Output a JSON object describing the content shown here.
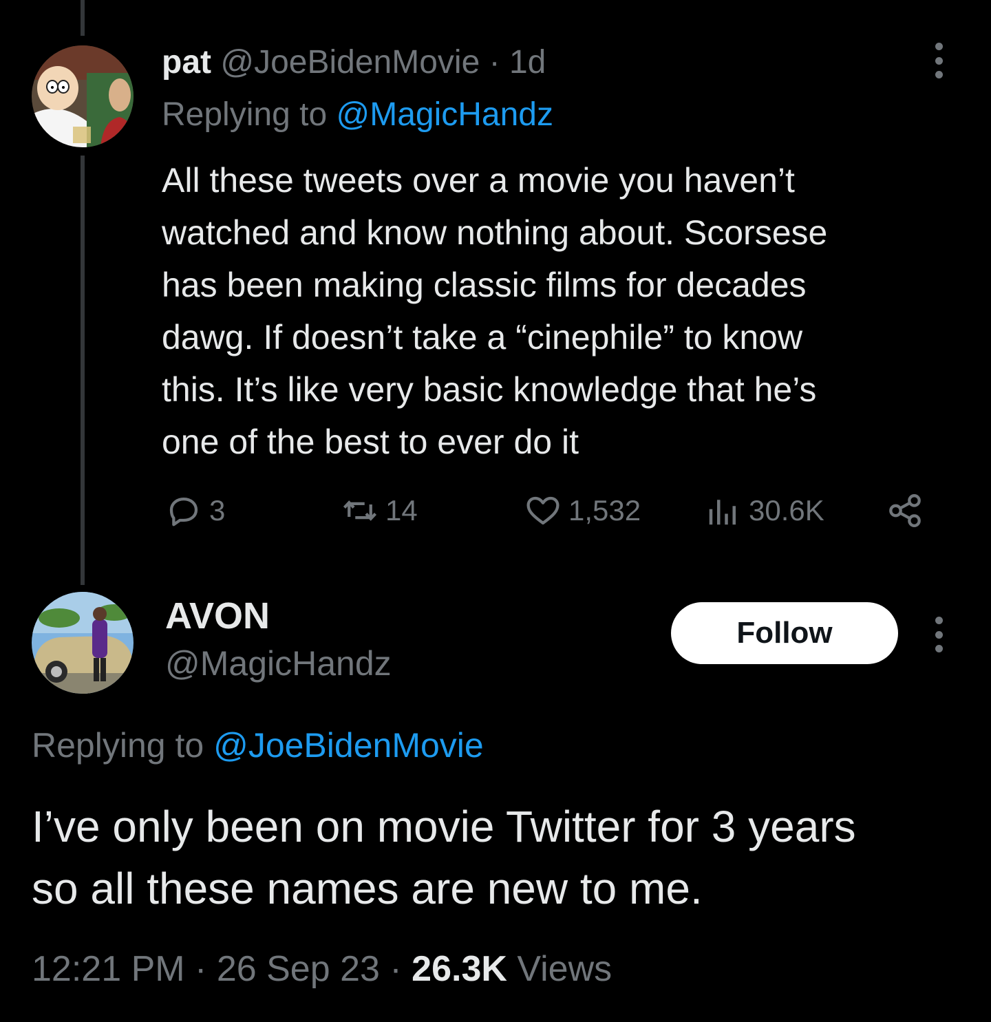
{
  "tweet1": {
    "display_name": "pat",
    "handle": "@JoeBidenMovie",
    "separator": "·",
    "age": "1d",
    "replying_prefix": "Replying to",
    "replying_to": "@MagicHandz",
    "body_lines": [
      "All these tweets over a movie you haven’t",
      "watched and know nothing about. Scorsese",
      "has been making classic films for decades",
      "dawg. If doesn’t take a “cinephile” to know",
      "this. It’s like very basic knowledge that he’s",
      "one of the best to ever do it"
    ],
    "actions": {
      "replies": "3",
      "retweets": "14",
      "likes": "1,532",
      "views": "30.6K"
    },
    "icons": {
      "reply": "reply-icon",
      "retweet": "retweet-icon",
      "like": "heart-icon",
      "views": "views-chart-icon",
      "share": "share-icon",
      "more": "more-vertical-icon"
    }
  },
  "tweet2": {
    "display_name": "AVON",
    "handle": "@MagicHandz",
    "follow_label": "Follow",
    "replying_prefix": "Replying to",
    "replying_to": "@JoeBidenMovie",
    "body_lines": [
      "I’ve only been on movie Twitter for 3 years",
      "so all these names are new to me."
    ],
    "time": "12:21 PM",
    "date": "26 Sep 23",
    "separator": "·",
    "views_count": "26.3K",
    "views_label": "Views"
  },
  "colors": {
    "background": "#000000",
    "text": "#e7e9ea",
    "muted": "#71767b",
    "link": "#1d9bf0",
    "thread_line": "#333639",
    "follow_bg": "#ffffff"
  }
}
